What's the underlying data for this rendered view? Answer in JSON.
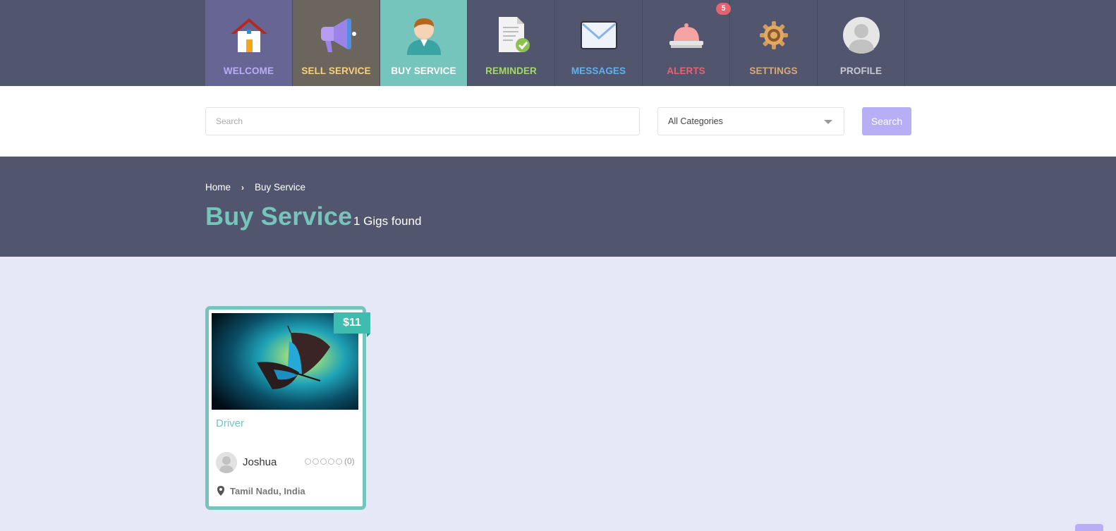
{
  "nav": {
    "items": [
      {
        "label": "WELCOME",
        "icon": "house-icon",
        "bg": "#676593",
        "color": "#b9aef6"
      },
      {
        "label": "SELL SERVICE",
        "icon": "megaphone-icon",
        "bg": "#6c655e",
        "color": "#f6d27b"
      },
      {
        "label": "BUY SERVICE",
        "icon": "buyer-person-icon",
        "bg": "#76c5bc",
        "color": "#ffffff"
      },
      {
        "label": "REMINDER",
        "icon": "document-check-icon",
        "bg": "#51566e",
        "color": "#a3d96a"
      },
      {
        "label": "MESSAGES",
        "icon": "envelope-icon",
        "bg": "#51566e",
        "color": "#60b0f0"
      },
      {
        "label": "ALERTS",
        "icon": "service-bell-icon",
        "bg": "#51566e",
        "color": "#e56270"
      },
      {
        "label": "SETTINGS",
        "icon": "gear-icon",
        "bg": "#51566e",
        "color": "#d9a877"
      },
      {
        "label": "PROFILE",
        "icon": "profile-avatar-icon",
        "bg": "#51566e",
        "color": "#c9c9d3"
      }
    ],
    "alerts_badge": "5"
  },
  "search": {
    "placeholder": "Search",
    "category": "All Categories",
    "button_label": "Search"
  },
  "breadcrumb": {
    "home": "Home",
    "separator": "›",
    "current": "Buy Service"
  },
  "page": {
    "title": "Buy Service",
    "count_text": "1 Gigs found"
  },
  "gig": {
    "price": "$11",
    "title": "Driver",
    "seller": "Joshua",
    "rating_stars": 0,
    "reviews": "(0)",
    "location": "Tamil Nadu, India"
  },
  "colors": {
    "accent_teal": "#76c5bc",
    "accent_purple": "#b8aef6",
    "header_bg": "#51566e",
    "page_bg": "#e6e8f8"
  }
}
